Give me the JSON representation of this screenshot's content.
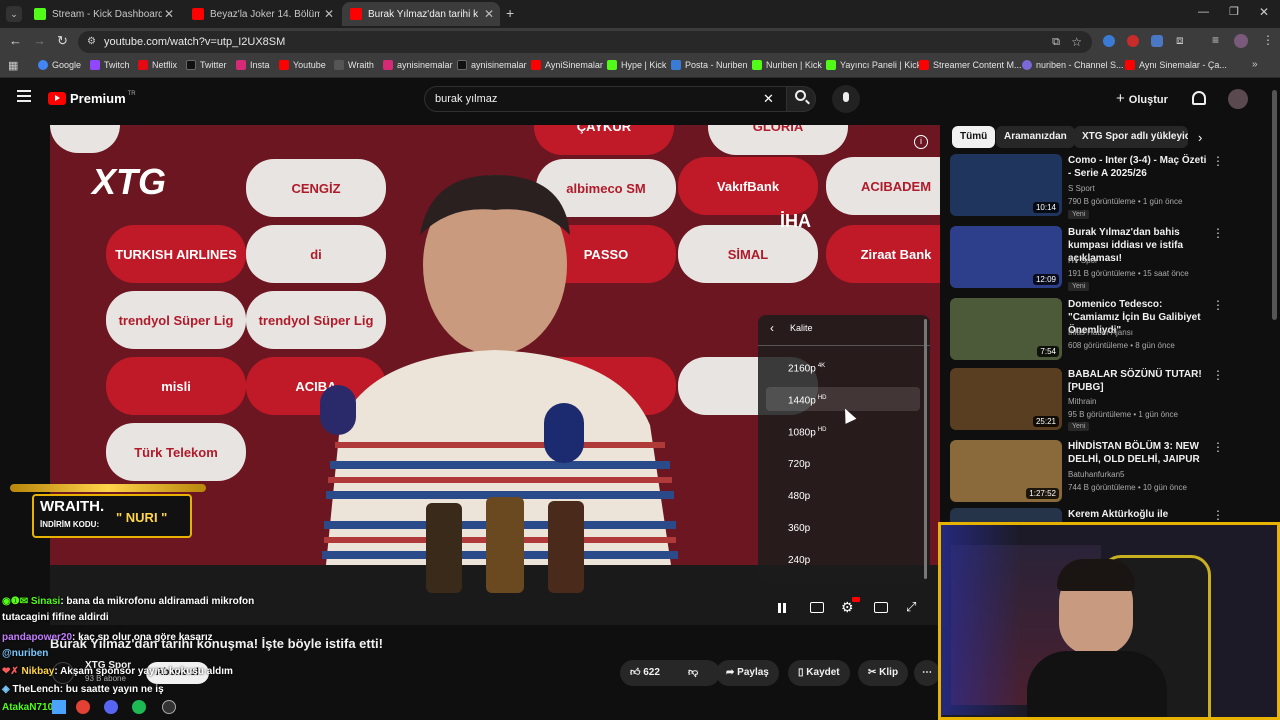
{
  "tabs": [
    {
      "label": "Stream - Kick Dashboard",
      "color": "#53fc18"
    },
    {
      "label": "Beyaz'la Joker 14. Bölüm - YouT",
      "color": "#ff0000"
    },
    {
      "label": "Burak Yılmaz'dan tarihi konuşm",
      "color": "#ff0000"
    }
  ],
  "address": "youtube.com/watch?v=utp_I2UX8SM",
  "bookmarks": [
    "Google",
    "Twitch",
    "Netflix",
    "Twitter",
    "Insta",
    "Youtube",
    "Wraith",
    "aynisinemalar",
    "aynisinemalar",
    "AyniSinemalar",
    "Hype | Kick",
    "Posta - Nuriben",
    "Nuriben | Kick",
    "Yayıncı Paneli | Kick",
    "Streamer Content M...",
    "nuriben - Channel S...",
    "Aynı Sinemalar - Ça..."
  ],
  "header": {
    "logo": "Premium",
    "logo_sup": "TR",
    "search": "burak yılmaz",
    "create": "Oluştur"
  },
  "video": {
    "channel_logo": "XTG",
    "watermark": "İHA",
    "sponsors": [
      "ÇAYKUR",
      "GLORIA",
      "CENGİZ",
      "albimeco SM",
      "VakıfBank",
      "ACIBADEM",
      "TURKISH AIRLINES",
      "di",
      "PASSO",
      "Ziraat Bank",
      "trendyol Süper Lig",
      "trendyol Süper Lig",
      "SİMAL",
      "misli",
      "ACIBA",
      "Türk Telekom"
    ],
    "quality_menu": {
      "title": "Kalite",
      "options": [
        {
          "label": "2160p",
          "badge": "4K"
        },
        {
          "label": "1440p",
          "badge": "HD"
        },
        {
          "label": "1080p",
          "badge": "HD"
        },
        {
          "label": "720p",
          "badge": ""
        },
        {
          "label": "480p",
          "badge": ""
        },
        {
          "label": "360p",
          "badge": ""
        },
        {
          "label": "240p",
          "badge": ""
        }
      ]
    }
  },
  "overlay": {
    "brand": "WRAITH.",
    "code_label": "İNDİRİM KODU:",
    "code": "\" NURI \""
  },
  "title": "Burak Yılmaz'dan tarihi konuşma! İşte böyle istifa etti!",
  "channel": {
    "name": "XTG Spor",
    "subs": "93 B abone",
    "subscribe": "Abone ol"
  },
  "actions": {
    "likes": "622",
    "share": "Paylaş",
    "save": "Kaydet",
    "clip": "Klip"
  },
  "chips": [
    "Tümü",
    "Aramanızdan",
    "XTG Spor adlı yükleyicid"
  ],
  "recommendations": [
    {
      "title": "Como - Inter (3-4) - Maç Özeti - Serie A 2025/26",
      "channel": "S Sport",
      "meta": "790 B görüntüleme • 1 gün önce",
      "badge": "Yeni",
      "duration": "10:14",
      "thumb": "#20355e"
    },
    {
      "title": "Burak Yılmaz'dan bahis kumpası iddiası ve istifa açıklaması!",
      "channel": "HT Spor",
      "meta": "191 B görüntüleme • 15 saat önce",
      "badge": "Yeni",
      "duration": "12:09",
      "thumb": "#2d3f8a"
    },
    {
      "title": "Domenico Tedesco: \"Camiamız İçin Bu Galibiyet Önemliydi\"",
      "channel": "İhlas Haber Ajansı",
      "meta": "608 görüntüleme • 8 gün önce",
      "badge": "",
      "duration": "7:54",
      "thumb": "#4d5a3a"
    },
    {
      "title": "BABALAR SÖZÜNÜ TUTAR! [PUBG]",
      "channel": "Mithrain",
      "meta": "95 B görüntüleme • 1 gün önce",
      "badge": "Yeni",
      "duration": "25:21",
      "thumb": "#5a3e22"
    },
    {
      "title": "HİNDİSTAN BÖLÜM 3: NEW DELHİ, OLD DELHİ, JAIPUR",
      "channel": "Batuhanfurkan5",
      "meta": "744 B görüntüleme • 10 gün önce",
      "badge": "",
      "duration": "1:27:52",
      "thumb": "#8a6a3a"
    },
    {
      "title": "Kerem Aktürkoğlu ile",
      "channel": "",
      "meta": "",
      "badge": "",
      "duration": "",
      "thumb": "#26344a"
    }
  ],
  "chat": [
    {
      "user": "Sinasi",
      "text": ": bana da mikrofonu aldiramadi mikrofon"
    },
    {
      "user": "",
      "text": "tutacagini fifine aldirdi"
    },
    {
      "user": "pandapower20",
      "text": ": kaç sp olur ona göre kasarız"
    },
    {
      "user": "@nuriben",
      "text": ""
    },
    {
      "user": "Nikbay",
      "text": ": Akşam sponsor yayını kokusu aldım"
    },
    {
      "user": "TheLench",
      "text": ": bu saatte yayın ne iş"
    },
    {
      "user": "AtakaN710",
      "text": ""
    }
  ],
  "colors": {
    "accent": "#ff0000",
    "overlay_gold": "#e8b300"
  }
}
